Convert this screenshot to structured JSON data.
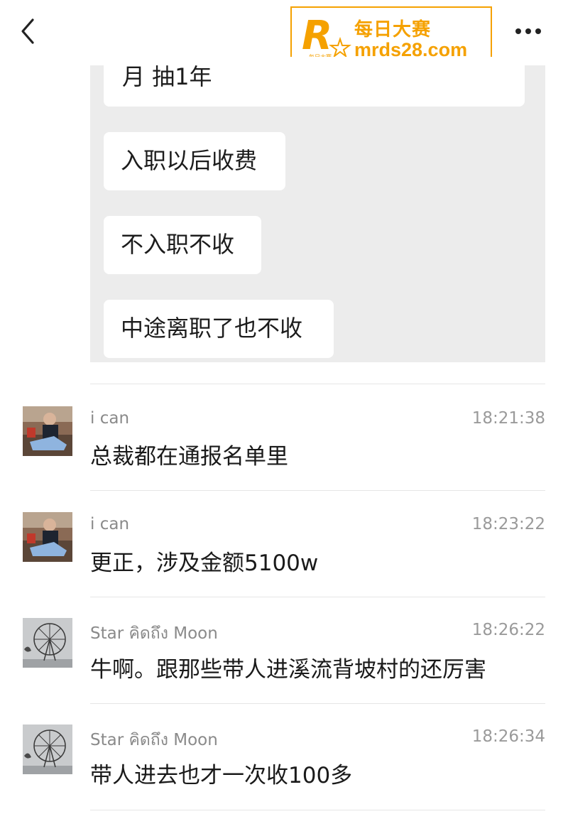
{
  "header": {
    "back_icon": "chevron-left-icon",
    "more_icon": "more-dots-icon"
  },
  "watermark": {
    "title": "每日大赛",
    "url": "mrds28.com",
    "mark_letter": "R",
    "mark_small": "每日大赛",
    "color": "#f5a100"
  },
  "quoted_messages": [
    "月 抽1年",
    "入职以后收费",
    "不入职不收",
    "中途离职了也不收"
  ],
  "messages": [
    {
      "name": "i can",
      "time": "18:21:38",
      "text": "总裁都在通报名单里"
    },
    {
      "name": "i can",
      "time": "18:23:22",
      "text": "更正，涉及金额5100w"
    },
    {
      "name": "Star คิดถึง Moon",
      "time": "18:26:22",
      "text": "牛啊。跟那些带人进溪流背坡村的还厉害"
    },
    {
      "name": "Star คิดถึง Moon",
      "time": "18:26:34",
      "text": "带人进去也才一次收100多"
    }
  ]
}
